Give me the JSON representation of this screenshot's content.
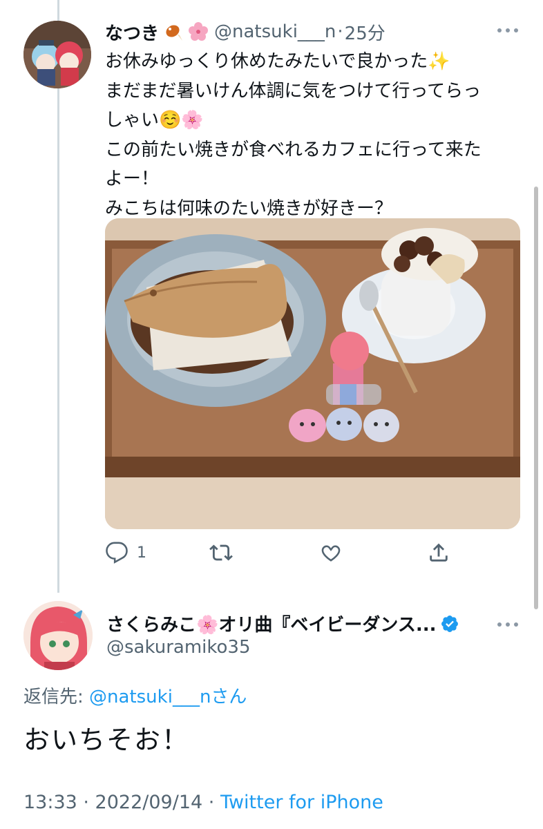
{
  "tweet": {
    "display_name": "なつき",
    "handle": "@natsuki___n",
    "time_sep": "·",
    "time": "25分",
    "lines": [
      "お休みゆっくり休めたみたいで良かった✨",
      "まだまだ暑いけん体調に気をつけて行ってらっ",
      "しゃい☺️🌸",
      "この前たい焼きが食べれるカフェに行って来た",
      "よー！",
      "みこちは何味のたい焼きが好きー？"
    ],
    "reply_count": "1",
    "icons": [
      "reply-icon",
      "retweet-icon",
      "like-icon",
      "share-icon"
    ]
  },
  "reply": {
    "display_name": "さくらみこ🌸オリ曲『ベイビーダンス...",
    "handle": "@sakuramiko35",
    "reply_label": "返信先: ",
    "reply_mention": "@natsuki___n",
    "reply_suffix": "さん",
    "text": "おいちそお！",
    "timestamp": "13:33 · 2022/09/14 · ",
    "source": "Twitter for iPhone"
  },
  "colors": {
    "accent": "#1d9bf0",
    "secondary_text": "#536471",
    "primary_text": "#0f1419"
  }
}
